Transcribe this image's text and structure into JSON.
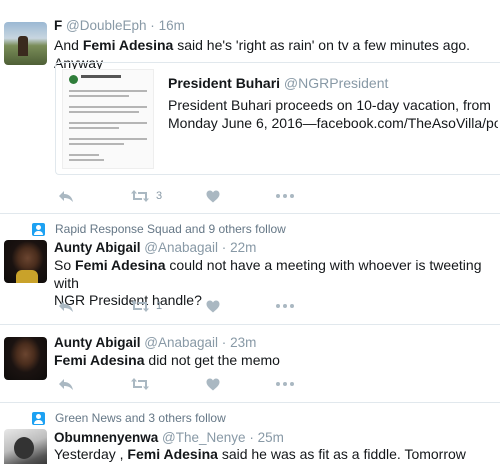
{
  "tweets": [
    {
      "name": "F",
      "handle": "@DoubleEph",
      "time": "16m",
      "text_before": "And ",
      "text_bold": "Femi Adesina",
      "text_after": " said he's 'right as rain' on tv a few minutes ago. Anyway",
      "card": {
        "name": "President Buhari",
        "handle": "@NGRPresident",
        "line1": "President Buhari proceeds on 10-day vacation, from",
        "line2": "Monday June 6, 2016—facebook.com/TheAsoVilla/po..."
      },
      "retweet_count": "3"
    },
    {
      "social": "Rapid Response Squad and 9 others follow",
      "name": "Aunty Abigail",
      "handle": "@Anabagail",
      "time": "22m",
      "text_before": "So ",
      "text_bold": "Femi Adesina",
      "text_after": " could not have a meeting with whoever is tweeting with",
      "text_line2": "NGR President handle?",
      "retweet_count": "1"
    },
    {
      "name": "Aunty Abigail",
      "handle": "@Anabagail",
      "time": "23m",
      "text_before": "",
      "text_bold": "Femi Adesina",
      "text_after": " did not get the memo"
    },
    {
      "social": "Green News and 3 others follow",
      "name": "Obumnenyenwa",
      "handle": "@The_Nenye",
      "time": "25m",
      "text_before": "Yesterday , ",
      "text_bold": "Femi Adesina",
      "text_after": " said he was as fit as a fiddle. Tomorrow  he's"
    }
  ],
  "colors": {
    "muted": "#8899a6",
    "action": "#aab8c2",
    "border": "#e1e8ed",
    "accent": "#1da1f2"
  },
  "icons": [
    "reply-icon",
    "retweet-icon",
    "like-icon",
    "more-icon",
    "follow-person-icon"
  ]
}
